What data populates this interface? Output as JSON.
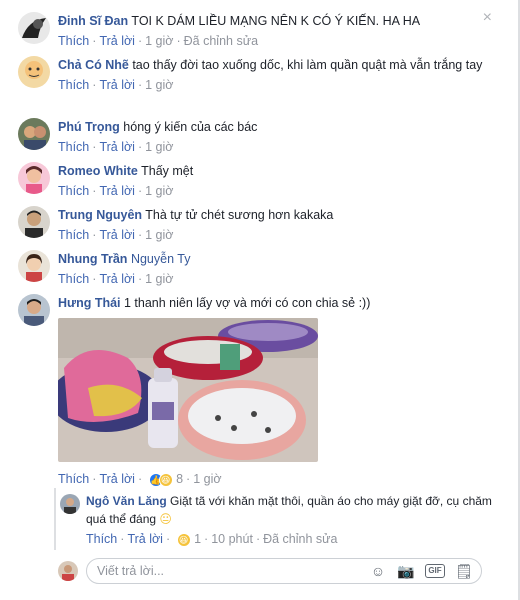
{
  "ui": {
    "like": "Thích",
    "reply": "Trả lời",
    "edited": "Đã chỉnh sửa",
    "close_icon": "×"
  },
  "comments": [
    {
      "name": "Đinh Sĩ Đan",
      "text": " TOI K DÁM LIỀU MẠNG NÊN K CÓ Ý KIẾN. HA HA",
      "time": "1 giờ",
      "edited": true
    },
    {
      "name": "Chả Có Nhẽ",
      "text": " tao thấy đời tao xuống dốc, khi làm quần quật mà vẫn trắng tay",
      "time": "1 giờ"
    },
    {
      "name": "Phú Trọng",
      "text": " hóng ý kiến của các bác",
      "time": "1 giờ"
    },
    {
      "name": "Romeo White",
      "text": " Thấy mệt",
      "time": "1 giờ"
    },
    {
      "name": "Trung Nguyên",
      "text": " Thà tự tử chét sương hơn kakaka",
      "time": "1 giờ"
    },
    {
      "name": "Nhung Trần",
      "text": "Nguyễn Ty",
      "time": "1 giờ"
    },
    {
      "name": "Hưng Thái",
      "text": " 1 thanh niên lấy vợ và mới có con chia sẻ :))",
      "time": "1 giờ",
      "reaction_count": "8"
    }
  ],
  "reply": {
    "name": "Ngô Văn Lăng",
    "text": " Giặt tã với khăn mặt thôi, quần áo cho máy giặt đỡ, cụ chăm quá thể đáng ",
    "time": "10 phút",
    "reaction_count": "1",
    "edited": true
  },
  "composer": {
    "placeholder": "Viết trả lời..."
  },
  "colors": {
    "link": "#365899",
    "action": "#4267b2",
    "meta": "#90949c",
    "border": "#dddfe2"
  }
}
